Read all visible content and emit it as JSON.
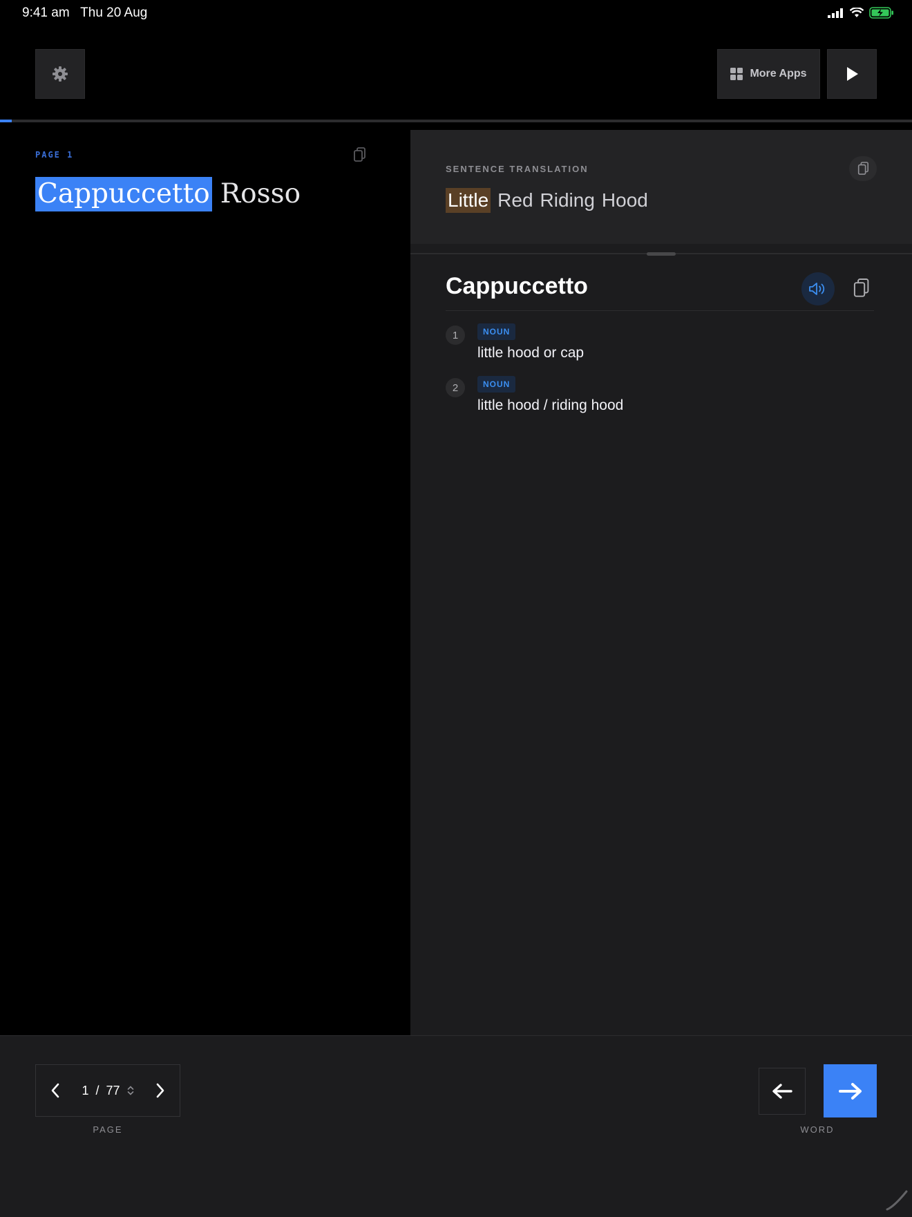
{
  "status_bar": {
    "time": "9:41 am",
    "date": "Thu 20 Aug"
  },
  "toolbar": {
    "more_apps_label": "More Apps"
  },
  "reader": {
    "page_label": "PAGE 1",
    "progress_fraction": 0.013,
    "sentence_words": [
      "Cappuccetto",
      "Rosso"
    ],
    "selected_word_index": 0
  },
  "translation": {
    "label": "SENTENCE TRANSLATION",
    "words": [
      "Little",
      "Red",
      "Riding",
      "Hood"
    ],
    "highlighted_index": 0
  },
  "dictionary": {
    "word": "Cappuccetto",
    "definitions": [
      {
        "number": "1",
        "pos": "NOUN",
        "text": "little hood or cap"
      },
      {
        "number": "2",
        "pos": "NOUN",
        "text": "little hood / riding hood"
      }
    ]
  },
  "footer": {
    "current_page": "1",
    "separator": "/",
    "total_pages": "77",
    "page_caption": "PAGE",
    "word_caption": "WORD"
  },
  "colors": {
    "accent": "#3b82f6",
    "translation_highlight": "#5a4026",
    "battery": "#34c759"
  },
  "icons": [
    "gear-icon",
    "grid-icon",
    "play-icon",
    "copy-icon",
    "speaker-icon",
    "chevron-left-icon",
    "chevron-right-icon",
    "sort-icon",
    "arrow-left-icon",
    "arrow-right-icon",
    "signal-icon",
    "wifi-icon",
    "battery-icon"
  ]
}
